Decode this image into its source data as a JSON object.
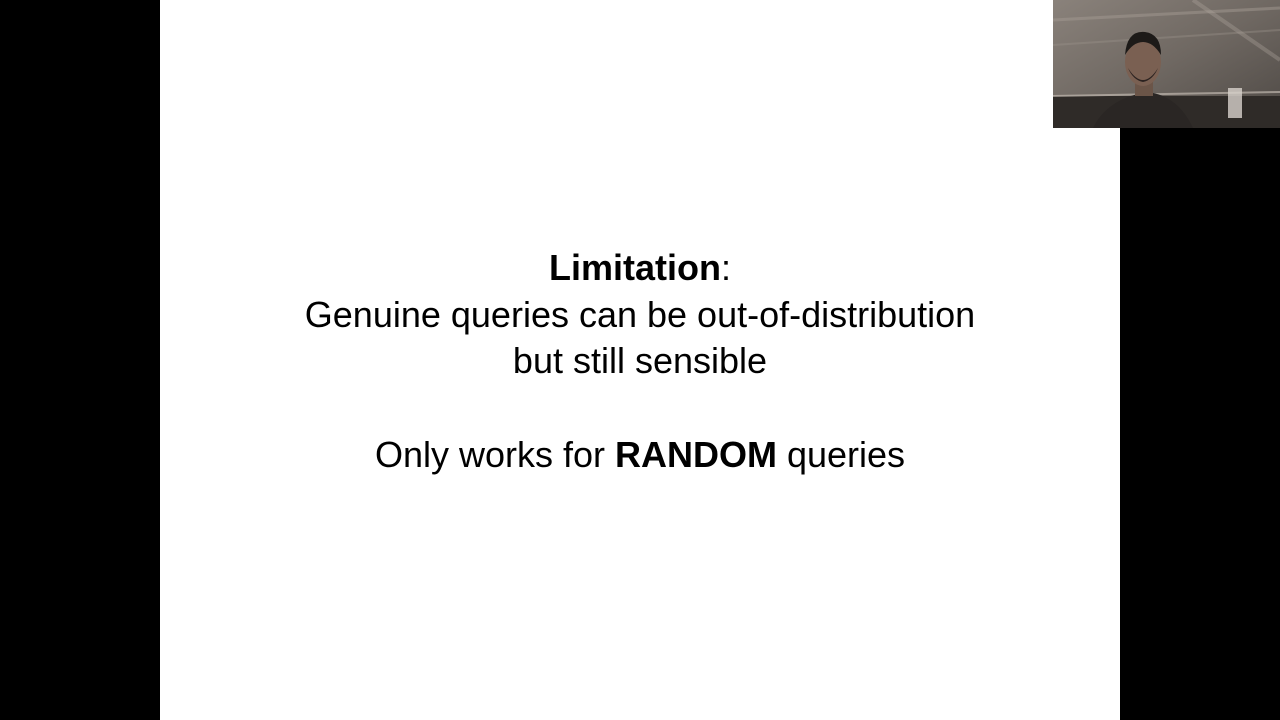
{
  "slide": {
    "title_bold": "Limitation",
    "title_rest": ":",
    "body_line1": "Genuine queries can be out-of-distribution",
    "body_line2": "but still sensible",
    "only_prefix": "Only works for ",
    "only_bold": "RANDOM",
    "only_suffix": " queries"
  },
  "colors": {
    "background": "#000000",
    "slide": "#ffffff",
    "text": "#000000"
  }
}
